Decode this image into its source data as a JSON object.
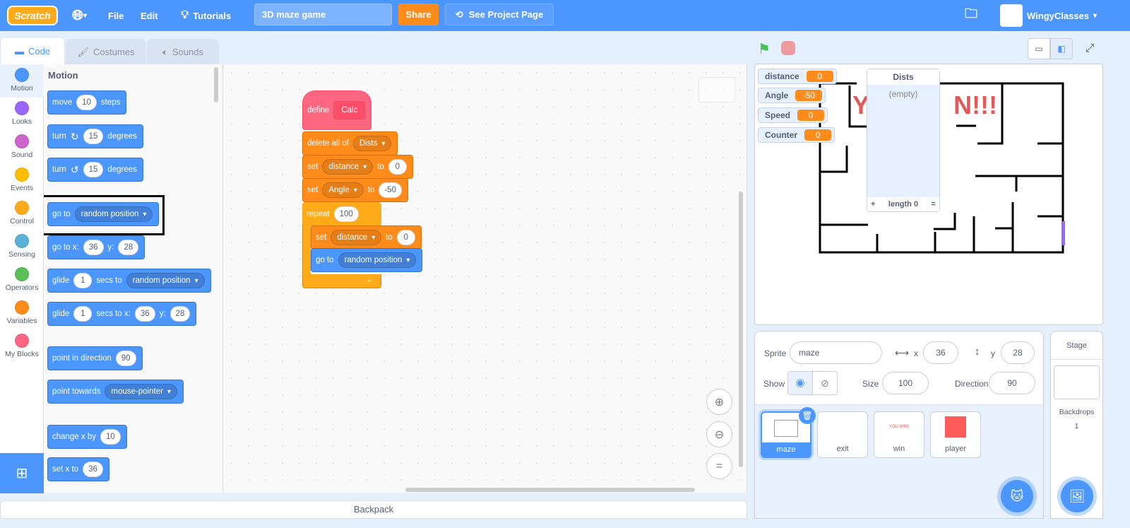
{
  "menu": {
    "logo": "Scratch",
    "file": "File",
    "edit": "Edit",
    "tutorials": "Tutorials",
    "project_title": "3D maze game",
    "share": "Share",
    "see_project": "See Project Page",
    "user": "WingyClasses",
    "accent": "#4c97ff"
  },
  "tabs": [
    {
      "label": "Code"
    },
    {
      "label": "Costumes"
    },
    {
      "label": "Sounds"
    }
  ],
  "categories": [
    {
      "label": "Motion",
      "color": "#4c97ff"
    },
    {
      "label": "Looks",
      "color": "#9966ff"
    },
    {
      "label": "Sound",
      "color": "#cf63cf"
    },
    {
      "label": "Events",
      "color": "#ffbf00"
    },
    {
      "label": "Control",
      "color": "#ffab19"
    },
    {
      "label": "Sensing",
      "color": "#5cb1d6"
    },
    {
      "label": "Operators",
      "color": "#59c059"
    },
    {
      "label": "Variables",
      "color": "#ff8c1a"
    },
    {
      "label": "My Blocks",
      "color": "#ff6680"
    }
  ],
  "palette": {
    "heading": "Motion",
    "blocks": [
      {
        "name": "move-steps-block",
        "parts": [
          [
            "t",
            "move"
          ],
          [
            "n",
            "10"
          ],
          [
            "t",
            "steps"
          ]
        ]
      },
      {
        "name": "turn-right-block",
        "parts": [
          [
            "t",
            "turn"
          ],
          [
            "i",
            "↻"
          ],
          [
            "n",
            "15"
          ],
          [
            "t",
            "degrees"
          ]
        ]
      },
      {
        "name": "turn-left-block",
        "parts": [
          [
            "t",
            "turn"
          ],
          [
            "i",
            "↺"
          ],
          [
            "n",
            "15"
          ],
          [
            "t",
            "degrees"
          ]
        ]
      },
      {
        "name": "go-to-random-block",
        "parts": [
          [
            "t",
            "go to"
          ],
          [
            "d",
            "random position"
          ]
        ]
      },
      {
        "name": "go-to-xy-block",
        "parts": [
          [
            "t",
            "go to x:"
          ],
          [
            "n",
            "36"
          ],
          [
            "t",
            "y:"
          ],
          [
            "n",
            "28"
          ]
        ]
      },
      {
        "name": "glide-to-block",
        "parts": [
          [
            "t",
            "glide"
          ],
          [
            "n",
            "1"
          ],
          [
            "t",
            "secs to"
          ],
          [
            "d",
            "random position"
          ]
        ]
      },
      {
        "name": "glide-to-xy-block",
        "parts": [
          [
            "t",
            "glide"
          ],
          [
            "n",
            "1"
          ],
          [
            "t",
            "secs to x:"
          ],
          [
            "n",
            "36"
          ],
          [
            "t",
            "y:"
          ],
          [
            "n",
            "28"
          ]
        ]
      },
      {
        "name": "point-in-direction-block",
        "parts": [
          [
            "t",
            "point in direction"
          ],
          [
            "n",
            "90"
          ]
        ]
      },
      {
        "name": "point-towards-block",
        "parts": [
          [
            "t",
            "point towards"
          ],
          [
            "d",
            "mouse-pointer"
          ]
        ]
      },
      {
        "name": "change-x-block",
        "parts": [
          [
            "t",
            "change x by"
          ],
          [
            "n",
            "10"
          ]
        ]
      },
      {
        "name": "set-x-block",
        "parts": [
          [
            "t",
            "set x to"
          ],
          [
            "n",
            "36"
          ]
        ]
      }
    ]
  },
  "script": [
    {
      "name": "define-calc-block",
      "cls": "myb",
      "parts": [
        [
          "t",
          "define"
        ],
        [
          "c",
          "Calc"
        ]
      ]
    },
    {
      "name": "delete-all-block",
      "cls": "vars",
      "parts": [
        [
          "t",
          "delete all of"
        ],
        [
          "d",
          "Dists"
        ]
      ]
    },
    {
      "name": "set-distance-block",
      "cls": "vars",
      "parts": [
        [
          "t",
          "set"
        ],
        [
          "d",
          "distance"
        ],
        [
          "t",
          "to"
        ],
        [
          "n",
          "0"
        ]
      ]
    },
    {
      "name": "set-angle-block",
      "cls": "vars",
      "parts": [
        [
          "t",
          "set"
        ],
        [
          "d",
          "Angle"
        ],
        [
          "t",
          "to"
        ],
        [
          "n",
          "-50"
        ]
      ]
    },
    {
      "name": "repeat-block",
      "cls": "ctrl",
      "parts": [
        [
          "t",
          "repeat"
        ],
        [
          "n",
          "100"
        ]
      ]
    },
    {
      "name": "set-distance-inner-block",
      "cls": "vars",
      "parts": [
        [
          "t",
          "set"
        ],
        [
          "d",
          "distance"
        ],
        [
          "t",
          "to"
        ],
        [
          "n",
          "0"
        ]
      ]
    },
    {
      "name": "go-to-random-inner-block",
      "cls": "motion",
      "parts": [
        [
          "t",
          "go to"
        ],
        [
          "d",
          "random position"
        ]
      ]
    }
  ],
  "backpack": "Backpack",
  "stage": {
    "monitors": [
      {
        "name": "distance",
        "value": "0"
      },
      {
        "name": "Angle",
        "value": "-50"
      },
      {
        "name": "Speed",
        "value": "0"
      },
      {
        "name": "Counter",
        "value": "0"
      }
    ],
    "list": {
      "title": "Dists",
      "empty": "(empty)",
      "add": "+",
      "length": "length 0",
      "resize": "="
    },
    "banner": "Y...N!!!"
  },
  "sprite_info": {
    "sprite_label": "Sprite",
    "sprite_name": "maze",
    "x_label": "x",
    "x": "36",
    "y_label": "y",
    "y": "28",
    "show_label": "Show",
    "size_label": "Size",
    "size": "100",
    "direction_label": "Direction",
    "direction": "90"
  },
  "sprites": [
    {
      "name": "maze",
      "selected": true
    },
    {
      "name": "exit"
    },
    {
      "name": "win",
      "thumb_text": "YOU WIN!"
    },
    {
      "name": "player",
      "color": "#ff5c5c"
    }
  ],
  "stage_panel": {
    "title": "Stage",
    "backdrops_label": "Backdrops",
    "backdrops": "1"
  }
}
